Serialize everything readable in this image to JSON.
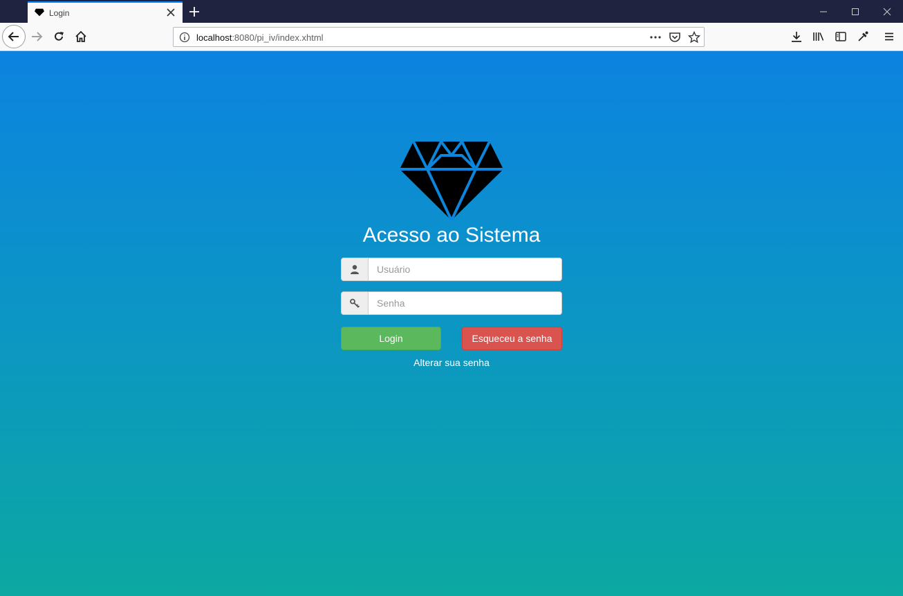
{
  "browser": {
    "tab_title": "Login",
    "url_host": "localhost",
    "url_rest": ":8080/pi_iv/index.xhtml"
  },
  "page": {
    "heading": "Acesso ao Sistema",
    "username_placeholder": "Usuário",
    "password_placeholder": "Senha",
    "login_label": "Login",
    "forgot_label": "Esqueceu a senha",
    "change_password_label": "Alterar sua senha"
  },
  "colors": {
    "gradient_top": "#0c83e0",
    "gradient_bottom": "#0ca8a1",
    "login_button": "#5cb85c",
    "forgot_button": "#d9534f",
    "tab_accent": "#0a84ff"
  },
  "icons": {
    "tab_favicon": "diamond-icon",
    "logo": "diamond-icon",
    "username_addon": "user-icon",
    "password_addon": "key-icon"
  }
}
